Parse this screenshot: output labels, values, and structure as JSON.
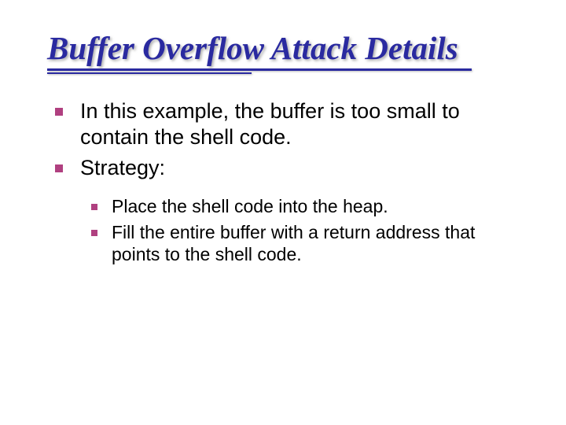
{
  "title": "Buffer Overflow Attack Details",
  "bullets": [
    {
      "text": "In this example, the buffer is too small to contain the shell code."
    },
    {
      "text": "Strategy:"
    }
  ],
  "subbullets": [
    {
      "text": "Place the shell code into the heap."
    },
    {
      "text": "Fill the entire buffer with a return address that points to the shell code."
    }
  ]
}
